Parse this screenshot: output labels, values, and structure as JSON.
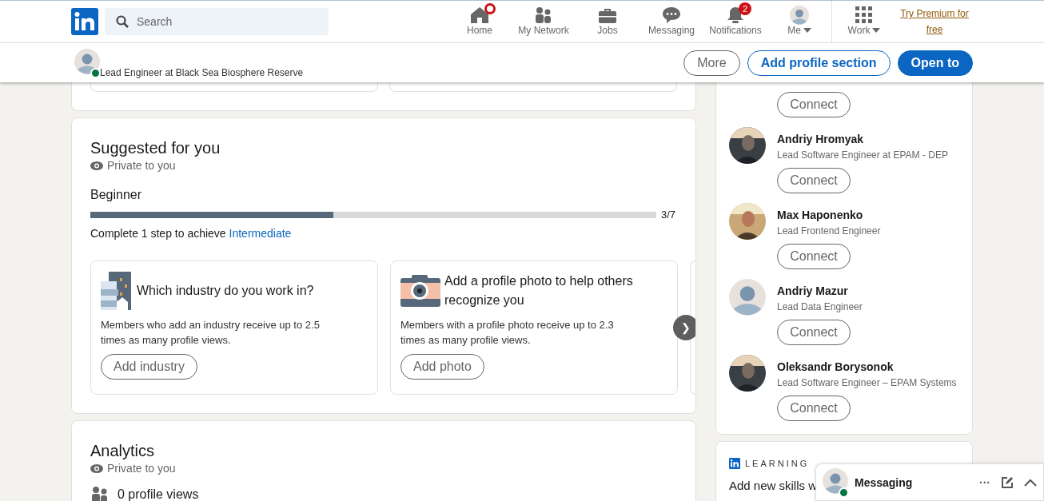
{
  "header": {
    "search": {
      "placeholder": "Search"
    },
    "nav": [
      {
        "label": "Home",
        "selected": false,
        "dot": true
      },
      {
        "label": "My Network",
        "selected": false
      },
      {
        "label": "Jobs",
        "selected": false
      },
      {
        "label": "Messaging",
        "selected": false
      },
      {
        "label": "Notifications",
        "selected": false,
        "badge": "2"
      },
      {
        "label": "Me",
        "selected": false,
        "dropdown": true
      },
      {
        "label": "Work",
        "selected": false,
        "dropdown": true
      }
    ],
    "premium_link": "Try Premium for free"
  },
  "profile_bar": {
    "headline": "Lead Engineer at Black Sea Biosphere Reserve",
    "online": true,
    "buttons": [
      {
        "label": "More",
        "kind": "plain"
      },
      {
        "label": "Add profile section",
        "kind": "outline"
      },
      {
        "label": "Open to",
        "kind": "primary"
      }
    ]
  },
  "suggested": {
    "title": "Suggested for you",
    "privacy": "Private to you",
    "level_name": "Beginner",
    "level": 0.43,
    "progress_text": "3/7",
    "hint": "Complete 1 step to achieve ",
    "hint_link": "Intermediate",
    "cards": [
      {
        "kind": "industry",
        "title": "Which industry do you work in?",
        "body": "Members who add an industry receive up to 2.5 times as many profile views.",
        "button": "Add industry"
      },
      {
        "kind": "camera",
        "title": "Add a profile photo to help others recognize you",
        "body": "Members with a profile photo receive up to 2.3 times as many profile views.",
        "button": "Add photo"
      }
    ],
    "next_button": "❯"
  },
  "analytics": {
    "title": "Analytics",
    "privacy": "Private to you",
    "stat": "0 profile views"
  },
  "people": {
    "first_button": "Connect",
    "items": [
      {
        "name": "Andriy Hromyak",
        "headline": "Lead Software Engineer at EPAM - DEP",
        "button": "Connect"
      },
      {
        "name": "Max Haponenko",
        "headline": "Lead Frontend Engineer",
        "button": "Connect"
      },
      {
        "name": "Andriy Mazur",
        "headline": "Lead Data Engineer",
        "kind": "default",
        "button": "Connect"
      },
      {
        "name": "Oleksandr Borysonok",
        "headline": "Lead Software Engineer – EPAM Systems",
        "button": "Connect"
      }
    ]
  },
  "learning": {
    "label": "LEARNING",
    "text": "Add new skills w"
  },
  "messaging": {
    "title": "Messaging",
    "online": true,
    "actions": [
      "···"
    ]
  }
}
